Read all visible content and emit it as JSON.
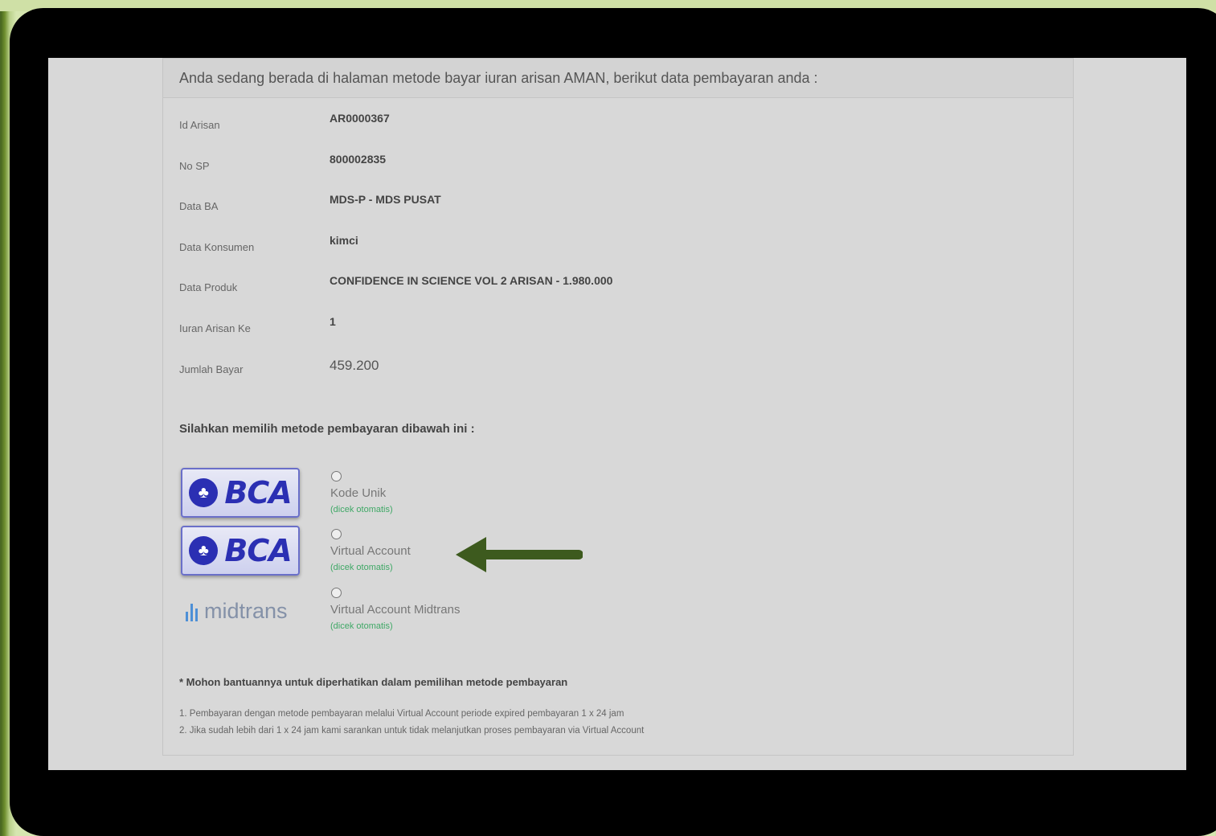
{
  "header": {
    "text": "Anda sedang berada di halaman metode bayar iuran arisan AMAN, berikut data pembayaran anda :"
  },
  "details": [
    {
      "label": "Id Arisan",
      "value": "AR0000367"
    },
    {
      "label": "No SP",
      "value": "800002835"
    },
    {
      "label": "Data BA",
      "value": "MDS-P - MDS PUSAT"
    },
    {
      "label": "Data Konsumen",
      "value": "kimci"
    },
    {
      "label": "Data Produk",
      "value": "CONFIDENCE IN SCIENCE VOL 2 ARISAN - 1.980.000"
    },
    {
      "label": "Iuran Arisan Ke",
      "value": "1"
    },
    {
      "label": "Jumlah Bayar",
      "value": "459.200"
    }
  ],
  "payment": {
    "prompt": "Silahkan memilih metode pembayaran dibawah ini :",
    "bca_logo_text": "BCA",
    "midtrans_logo_text": "midtrans",
    "options": [
      {
        "label": "Kode Unik",
        "note": "(dicek otomatis)",
        "logo": "bca"
      },
      {
        "label": "Virtual Account",
        "note": "(dicek otomatis)",
        "logo": "bca"
      },
      {
        "label": "Virtual Account Midtrans",
        "note": "(dicek otomatis)",
        "logo": "midtrans"
      }
    ]
  },
  "notice": {
    "title": "* Mohon bantuannya untuk diperhatikan dalam pemilihan metode pembayaran",
    "lines": [
      "1. Pembayaran dengan metode pembayaran melalui Virtual Account periode expired pembayaran 1 x 24 jam",
      "2. Jika sudah lebih dari 1 x 24 jam kami sarankan untuk tidak melanjutkan proses pembayaran via Virtual Account"
    ]
  },
  "colors": {
    "arrow": "#3d5a1e",
    "bca_blue": "#2b2fb3",
    "note_green": "#3fa866"
  },
  "icons": {
    "arrow": "arrow-left-icon",
    "radio": "radio-unchecked-icon"
  }
}
